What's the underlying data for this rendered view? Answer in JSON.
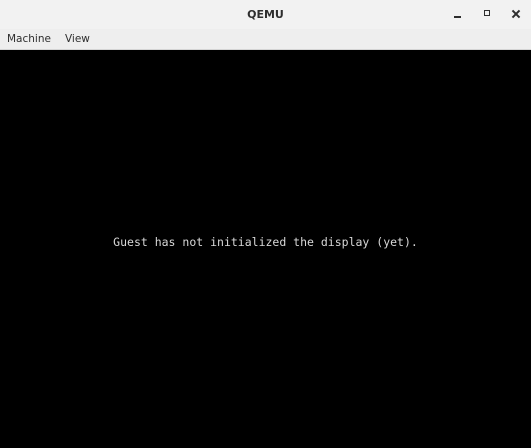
{
  "window": {
    "title": "QEMU"
  },
  "titlebar": {
    "controls": {
      "minimize_icon": "minimize-icon",
      "maximize_icon": "maximize-icon",
      "close_icon": "close-icon"
    }
  },
  "menubar": {
    "items": [
      {
        "label": "Machine"
      },
      {
        "label": "View"
      }
    ]
  },
  "display": {
    "message": "Guest has not initialized the display (yet).",
    "background": "#000000",
    "text_color": "#d8d8d8"
  }
}
